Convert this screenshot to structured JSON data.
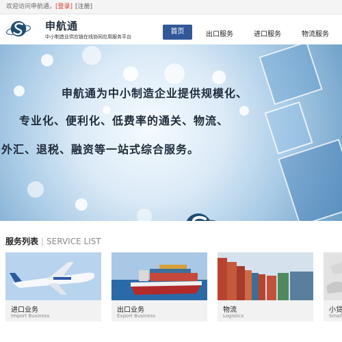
{
  "topbar": {
    "welcome": "欢迎访问申航通，",
    "login": "[登录]",
    "register": "[注册]"
  },
  "header": {
    "brand_name": "申航通",
    "brand_tagline": "中小制造业供应链在线协同应用服务平台"
  },
  "nav": [
    {
      "label": "首页",
      "active": true
    },
    {
      "label": "出口服务"
    },
    {
      "label": "进口服务"
    },
    {
      "label": "物流服务"
    }
  ],
  "banner": {
    "line1": "申航通为中小制造企业提供规模化、",
    "line2": "专业化、便利化、低费率的通关、物流、",
    "line3": "外汇、退税、融资等一站式综合服务。"
  },
  "services": {
    "title_cn": "服务列表",
    "title_sep": "|",
    "title_en": "SERVICE LIST",
    "cards": [
      {
        "label": "进口业务",
        "sub": "Import Business"
      },
      {
        "label": "出口业务",
        "sub": "Export Business"
      },
      {
        "label": "物流",
        "sub": "Logistics"
      },
      {
        "label": "小贷",
        "sub": "Small"
      }
    ]
  },
  "colors": {
    "nav_active": "#33589a",
    "login_link": "#e03a2a",
    "brand_dark": "#1f2d3d"
  }
}
